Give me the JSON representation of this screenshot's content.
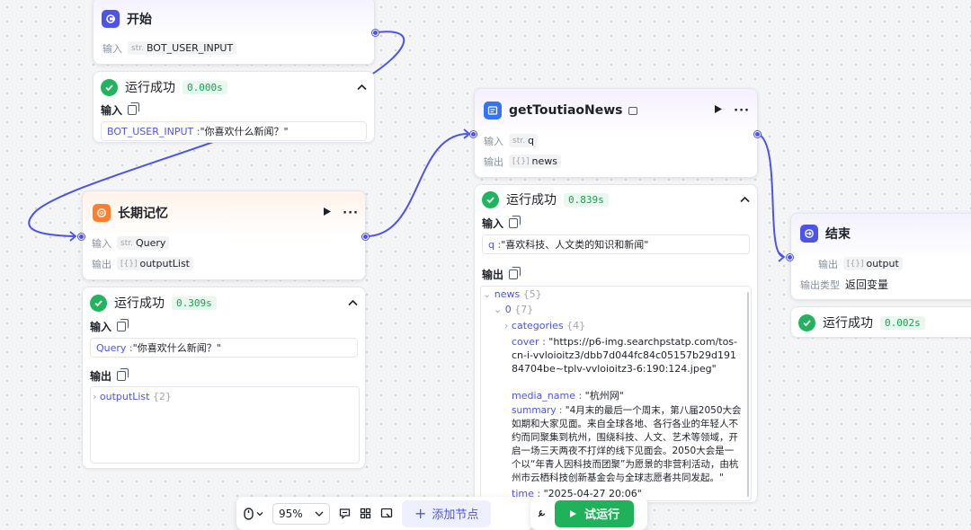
{
  "nodes": {
    "start": {
      "title": "开始",
      "input_key": "输入",
      "input_type": "str.",
      "input_name": "BOT_USER_INPUT"
    },
    "start_result": {
      "status": "运行成功",
      "time": "0.000s",
      "input_label": "输入",
      "kv_key": "BOT_USER_INPUT :",
      "kv_value": "\"你喜欢什么新闻？\""
    },
    "memory": {
      "title": "长期记忆",
      "input_key": "输入",
      "input_type": "str.",
      "input_name": "Query",
      "output_key": "输出",
      "output_type": "[{}]",
      "output_name": "outputList"
    },
    "memory_result": {
      "status": "运行成功",
      "time": "0.309s",
      "input_label": "输入",
      "kv_key": "Query :",
      "kv_value": "\"你喜欢什么新闻？\"",
      "output_label": "输出",
      "tree_key": "outputList",
      "tree_count": "{2}"
    },
    "news": {
      "title": "getToutiaoNews",
      "input_key": "输入",
      "input_type": "str.",
      "input_name": "q",
      "output_key": "输出",
      "output_type": "[{}]",
      "output_name": "news"
    },
    "news_result": {
      "status": "运行成功",
      "time": "0.839s",
      "input_label": "输入",
      "kv_key": "q :",
      "kv_value": "\"喜欢科技、人文类的知识和新闻\"",
      "output_label": "输出",
      "tree": {
        "news_key": "news",
        "news_count": "{5}",
        "item0_key": "0",
        "item0_count": "{7}",
        "categories_key": "categories",
        "categories_count": "{4}",
        "cover_key": "cover :",
        "cover_value": "\"https://p6-img.searchpstatp.com/tos-cn-i-vvloioitz3/dbb7d044fc84c05157b29d19184704be~tplv-vvloioitz3-6:190:124.jpeg\"",
        "media_key": "media_name :",
        "media_value": "\"杭州网\"",
        "summary_key": "summary :",
        "summary_value": "\"4月末的最后一个周末，第八届2050大会如期和大家见面。来自全球各地、各行各业的年轻人不约而同聚集到杭州，围绕科技、人文、艺术等领域，开启一场三天两夜不打烊的线下见面会。2050大会是一个以“年青人因科技而团聚”为愿景的非营利活动，由杭州市云栖科技创新基金会与全球志愿者共同发起。\"",
        "time_key": "time :",
        "time_value": "\"2025-04-27 20:06\""
      }
    },
    "end": {
      "title": "结束",
      "output_key": "输出",
      "output_type": "[{}]",
      "output_name": "output",
      "output_kind_key": "输出类型",
      "output_kind_value": "返回变量"
    },
    "end_result": {
      "status": "运行成功",
      "time": "0.002s"
    }
  },
  "toolbar": {
    "zoom": "95%",
    "add_node": "添加节点",
    "run": "试运行"
  },
  "colors": {
    "accent": "#4d53e8",
    "success": "#22b35e",
    "run_button": "#1fb25a",
    "memory_icon": "#ff7d2e"
  }
}
